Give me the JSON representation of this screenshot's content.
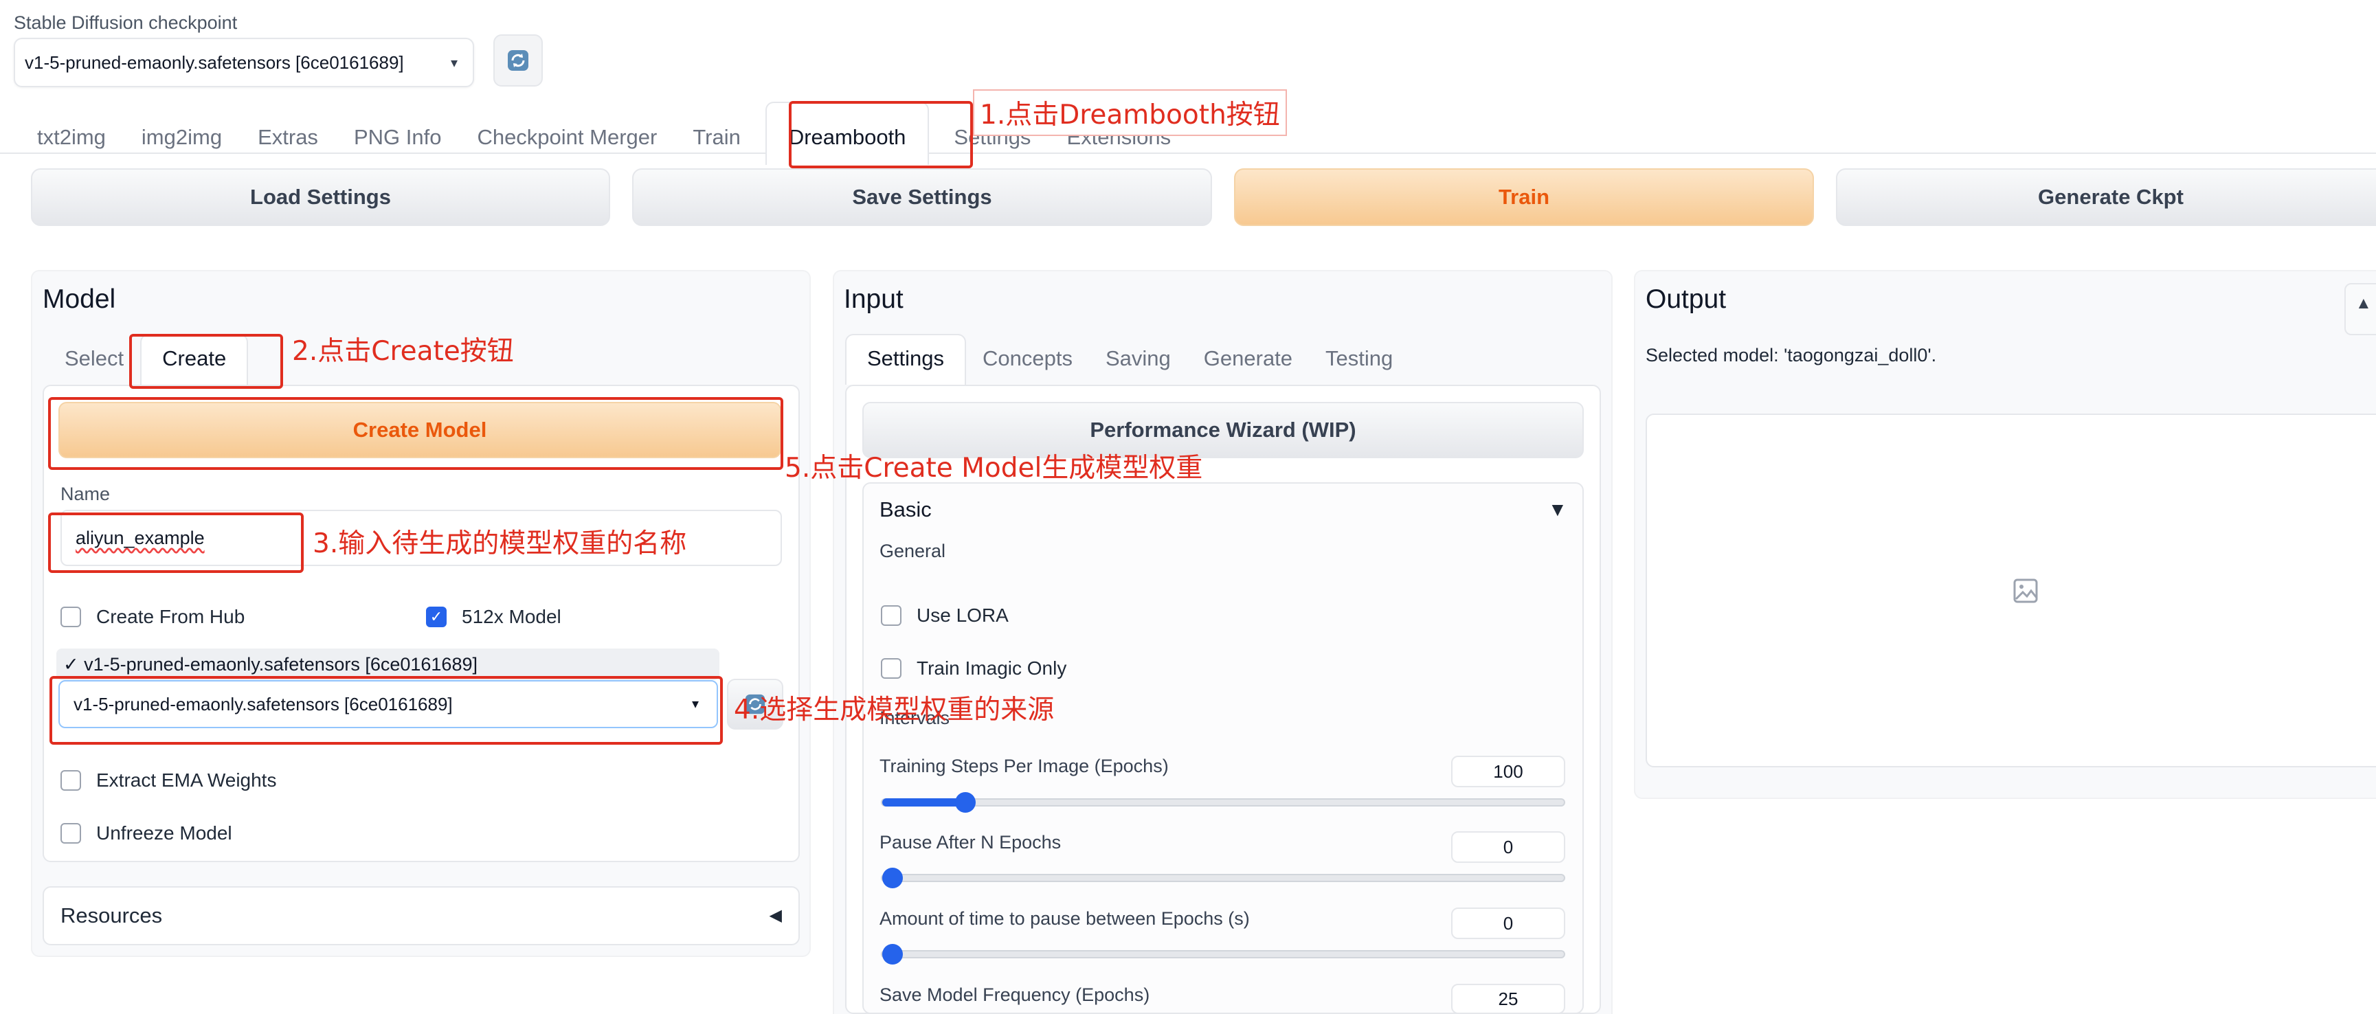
{
  "checkpoint": {
    "label": "Stable Diffusion checkpoint",
    "selected": "v1-5-pruned-emaonly.safetensors [6ce0161689]"
  },
  "main_tabs": [
    "txt2img",
    "img2img",
    "Extras",
    "PNG Info",
    "Checkpoint Merger",
    "Train",
    "Dreambooth",
    "Settings",
    "Extensions"
  ],
  "actions": {
    "load": "Load Settings",
    "save": "Save Settings",
    "train": "Train",
    "generate": "Generate Ckpt"
  },
  "model_panel": {
    "title": "Model",
    "tabs": [
      "Select",
      "Create"
    ],
    "create_button": "Create Model",
    "name_label": "Name",
    "name_value": "aliyun_example",
    "create_from_hub": "Create From Hub",
    "create_from_hub_checked": false,
    "model_512x": "512x Model",
    "model_512x_checked": true,
    "source_dropdown_option": "✓ v1-5-pruned-emaonly.safetensors [6ce0161689]",
    "source_value": "v1-5-pruned-emaonly.safetensors [6ce0161689]",
    "extract_ema": "Extract EMA Weights",
    "unfreeze": "Unfreeze Model",
    "resources": "Resources"
  },
  "input_panel": {
    "title": "Input",
    "tabs": [
      "Settings",
      "Concepts",
      "Saving",
      "Generate",
      "Testing"
    ],
    "wizard_button": "Performance Wizard (WIP)",
    "basic": "Basic",
    "general": "General",
    "use_lora": "Use LORA",
    "train_imagic": "Train Imagic Only",
    "intervals": "Intervals",
    "sliders": [
      {
        "label": "Training Steps Per Image (Epochs)",
        "value": "100",
        "fraction": 0.11
      },
      {
        "label": "Pause After N Epochs",
        "value": "0",
        "fraction": 0.0
      },
      {
        "label": "Amount of time to pause between Epochs (s)",
        "value": "0",
        "fraction": 0.0
      },
      {
        "label": "Save Model Frequency (Epochs)",
        "value": "25",
        "fraction": 0.0
      }
    ]
  },
  "output_panel": {
    "title": "Output",
    "selected_model": "Selected model: 'taogongzai_doll0'."
  },
  "annotations": {
    "step1": "1.点击Dreambooth按钮",
    "step2": "2.点击Create按钮",
    "step3": "3.输入待生成的模型权重的名称",
    "step4": "4.选择生成模型权重的来源",
    "step5": "5.点击Create Model生成模型权重"
  },
  "colors": {
    "accent_orange": "#ea580c",
    "annotation_red": "#e02d1f",
    "checkbox_blue": "#2563eb"
  }
}
